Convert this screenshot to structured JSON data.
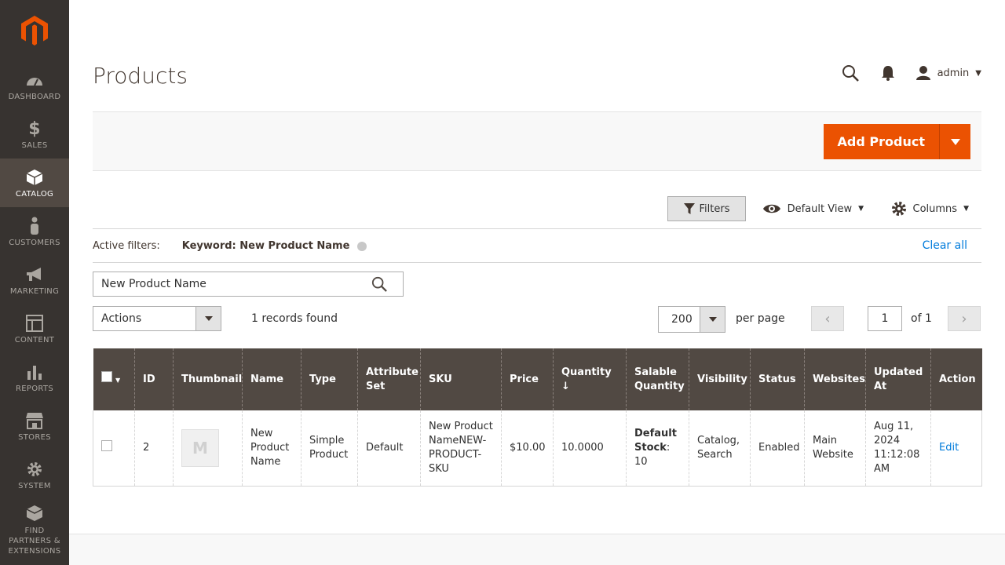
{
  "sidebar": {
    "items": [
      {
        "label": "DASHBOARD"
      },
      {
        "label": "SALES"
      },
      {
        "label": "CATALOG"
      },
      {
        "label": "CUSTOMERS"
      },
      {
        "label": "MARKETING"
      },
      {
        "label": "CONTENT"
      },
      {
        "label": "REPORTS"
      },
      {
        "label": "STORES"
      },
      {
        "label": "SYSTEM"
      },
      {
        "label": "FIND PARTNERS & EXTENSIONS"
      }
    ]
  },
  "header": {
    "title": "Products",
    "user": "admin"
  },
  "page_actions": {
    "add_product": "Add Product"
  },
  "toolbar": {
    "filters": "Filters",
    "default_view": "Default View",
    "columns": "Columns"
  },
  "active_filters": {
    "label": "Active filters:",
    "chip": "Keyword: New Product Name",
    "clear_all": "Clear all"
  },
  "search": {
    "value": "New Product Name"
  },
  "grid_controls": {
    "actions": "Actions",
    "records": "1 records found",
    "per_page_value": "200",
    "per_page_label": "per page",
    "page": "1",
    "of": "of 1"
  },
  "table": {
    "headers": {
      "id": "ID",
      "thumbnail": "Thumbnail",
      "name": "Name",
      "type": "Type",
      "attribute_set": "Attribute Set",
      "sku": "SKU",
      "price": "Price",
      "quantity": "Quantity",
      "salable_quantity": "Salable Quantity",
      "visibility": "Visibility",
      "status": "Status",
      "websites": "Websites",
      "updated_at": "Updated At",
      "action": "Action"
    },
    "row": {
      "id": "2",
      "name": "New Product Name",
      "type": "Simple Product",
      "attribute_set": "Default",
      "sku": "New Product NameNEW-PRODUCT-SKU",
      "price": "$10.00",
      "quantity": "10.0000",
      "salable_label": "Default Stock",
      "salable_value": ": 10",
      "visibility": "Catalog, Search",
      "status": "Enabled",
      "websites": "Main Website",
      "updated_at": "Aug 11, 2024 11:12:08 AM",
      "action": "Edit"
    }
  }
}
